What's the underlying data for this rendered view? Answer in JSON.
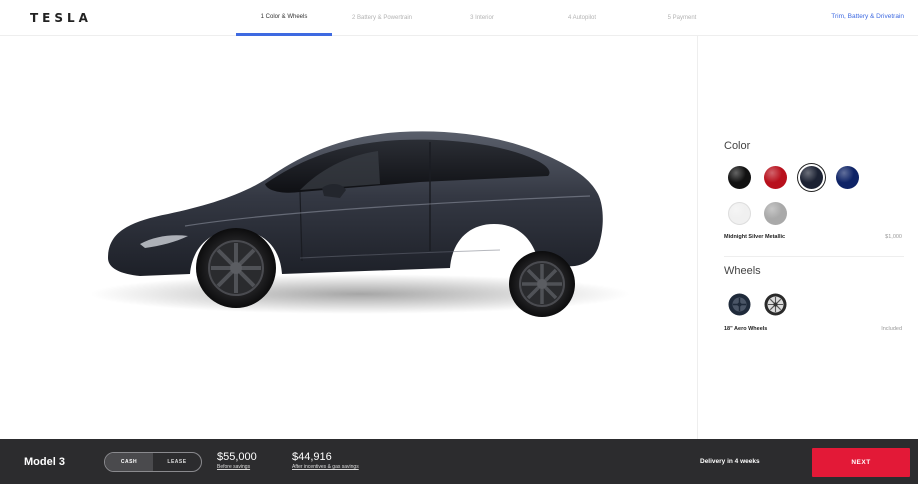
{
  "header": {
    "logo": "TESLA",
    "steps": [
      "1 Color & Wheels",
      "2 Battery & Powertrain",
      "3 Interior",
      "4 Autopilot",
      "5 Payment"
    ],
    "active_step_index": 0,
    "link": "Trim, Battery & Drivetrain"
  },
  "panel": {
    "color_title": "Color",
    "colors": [
      {
        "name": "black",
        "hex": "#111111"
      },
      {
        "name": "red",
        "hex": "#b8101c"
      },
      {
        "name": "midnight-silver",
        "hex": "#1c2233"
      },
      {
        "name": "deep-blue",
        "hex": "#0e2366"
      },
      {
        "name": "white",
        "hex": "#f0f0f0"
      },
      {
        "name": "silver",
        "hex": "#a9a9a9"
      }
    ],
    "selected_color_index": 2,
    "selected_color_name": "Midnight Silver Metallic",
    "selected_color_price": "$1,000",
    "wheels_title": "Wheels",
    "selected_wheel_name": "18\" Aero Wheels",
    "selected_wheel_price": "Included"
  },
  "footer": {
    "model": "Model 3",
    "toggle": [
      "CASH",
      "LEASE"
    ],
    "toggle_selected_index": 0,
    "price_before": "$55,000",
    "price_before_label": "Before savings",
    "price_after": "$44,916",
    "price_after_label": "After incentives & gas savings",
    "delivery": "Delivery in 4 weeks",
    "next_label": "NEXT"
  },
  "colors": {
    "accent_blue": "#3e6ae1",
    "next_red": "#e31937",
    "footer_bg": "#2c2c2e"
  }
}
